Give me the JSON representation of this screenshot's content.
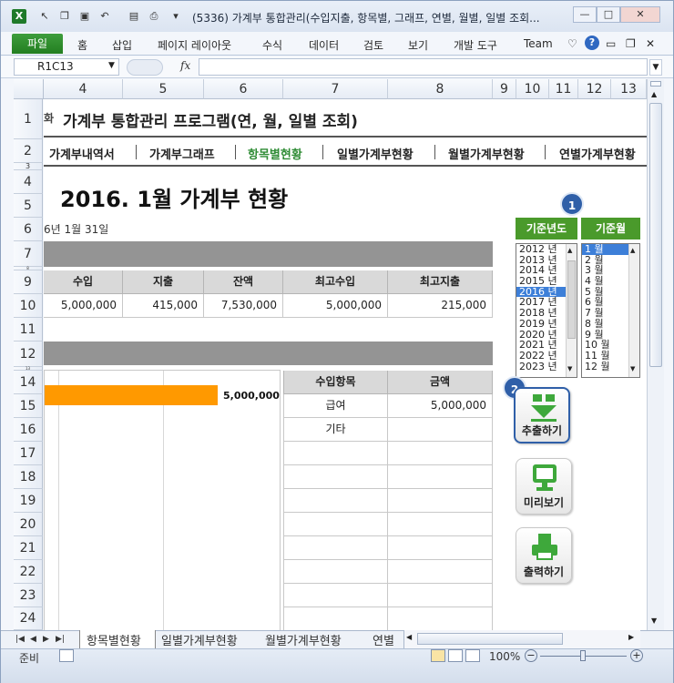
{
  "window": {
    "title": "(5336) 가계부 통합관리(수입지출, 항목별, 그래프, 연별, 월별, 일별 조회...",
    "minimize": "—",
    "maximize": "□",
    "close": "✕"
  },
  "ribbon": {
    "tabs": [
      "파일",
      "홈",
      "삽입",
      "페이지 레이아웃",
      "수식",
      "데이터",
      "검토",
      "보기",
      "개발 도구",
      "Team"
    ]
  },
  "formula_bar": {
    "cell_ref": "R1C13",
    "fx": "fx",
    "value": ""
  },
  "columns": [
    "4",
    "5",
    "6",
    "7",
    "8",
    "9",
    "10",
    "11",
    "12",
    "13"
  ],
  "rows": [
    "1",
    "2",
    "3",
    "4",
    "5",
    "6",
    "7",
    "8",
    "9",
    "10",
    "11",
    "12",
    "13",
    "14",
    "15",
    "16",
    "17",
    "18",
    "19",
    "20",
    "21",
    "22",
    "23",
    "24"
  ],
  "sheet": {
    "app_title_prefix": "화",
    "app_title": "가계부 통합관리 프로그램(연, 월, 일별 조회)",
    "nav": [
      "가계부내역서",
      "가계부그래프",
      "항목별현황",
      "일별가계부현황",
      "월별가계부현황",
      "연별가계부현황"
    ],
    "nav_active": "항목별현황",
    "heading": "2016. 1월 가계부 현황",
    "date": "6년 1월 31일",
    "summary_headers": [
      "수입",
      "지출",
      "잔액",
      "최고수입",
      "최고지출"
    ],
    "summary_values": [
      "5,000,000",
      "415,000",
      "7,530,000",
      "5,000,000",
      "215,000"
    ],
    "chart_bar_label": "5,000,000",
    "income_headers": [
      "수입항목",
      "금액"
    ],
    "income_rows": [
      {
        "item": "급여",
        "amount": "5,000,000"
      },
      {
        "item": "기타",
        "amount": ""
      }
    ]
  },
  "selector": {
    "year_header": "기준년도",
    "month_header": "기준월",
    "years": [
      "2012 년",
      "2013 년",
      "2014 년",
      "2015 년",
      "2016 년",
      "2017 년",
      "2018 년",
      "2019 년",
      "2020 년",
      "2021 년",
      "2022 년",
      "2023 년"
    ],
    "selected_year": "2016 년",
    "months": [
      "1 월",
      "2 월",
      "3 월",
      "4 월",
      "5 월",
      "6 월",
      "7 월",
      "8 월",
      "9 월",
      "10 월",
      "11 월",
      "12 월"
    ],
    "selected_month": "1 월",
    "badge1": "1",
    "badge2": "2"
  },
  "buttons": {
    "extract": "추출하기",
    "preview": "미리보기",
    "print": "출력하기"
  },
  "sheet_tabs": [
    "항목별현황",
    "일별가계부현황",
    "월별가계부현황",
    "연별"
  ],
  "status": {
    "ready": "준비",
    "zoom": "100%"
  },
  "colors": {
    "green_accent": "#4a9a2b",
    "selection_blue": "#3d7fd8",
    "bar_orange": "#ff9900"
  }
}
